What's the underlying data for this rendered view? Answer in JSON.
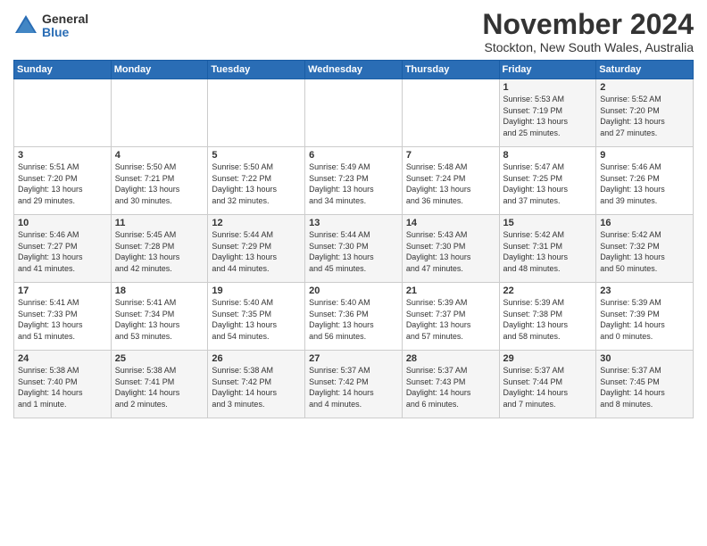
{
  "logo": {
    "general": "General",
    "blue": "Blue"
  },
  "title": "November 2024",
  "subtitle": "Stockton, New South Wales, Australia",
  "headers": [
    "Sunday",
    "Monday",
    "Tuesday",
    "Wednesday",
    "Thursday",
    "Friday",
    "Saturday"
  ],
  "weeks": [
    [
      {
        "day": "",
        "info": ""
      },
      {
        "day": "",
        "info": ""
      },
      {
        "day": "",
        "info": ""
      },
      {
        "day": "",
        "info": ""
      },
      {
        "day": "",
        "info": ""
      },
      {
        "day": "1",
        "info": "Sunrise: 5:53 AM\nSunset: 7:19 PM\nDaylight: 13 hours\nand 25 minutes."
      },
      {
        "day": "2",
        "info": "Sunrise: 5:52 AM\nSunset: 7:20 PM\nDaylight: 13 hours\nand 27 minutes."
      }
    ],
    [
      {
        "day": "3",
        "info": "Sunrise: 5:51 AM\nSunset: 7:20 PM\nDaylight: 13 hours\nand 29 minutes."
      },
      {
        "day": "4",
        "info": "Sunrise: 5:50 AM\nSunset: 7:21 PM\nDaylight: 13 hours\nand 30 minutes."
      },
      {
        "day": "5",
        "info": "Sunrise: 5:50 AM\nSunset: 7:22 PM\nDaylight: 13 hours\nand 32 minutes."
      },
      {
        "day": "6",
        "info": "Sunrise: 5:49 AM\nSunset: 7:23 PM\nDaylight: 13 hours\nand 34 minutes."
      },
      {
        "day": "7",
        "info": "Sunrise: 5:48 AM\nSunset: 7:24 PM\nDaylight: 13 hours\nand 36 minutes."
      },
      {
        "day": "8",
        "info": "Sunrise: 5:47 AM\nSunset: 7:25 PM\nDaylight: 13 hours\nand 37 minutes."
      },
      {
        "day": "9",
        "info": "Sunrise: 5:46 AM\nSunset: 7:26 PM\nDaylight: 13 hours\nand 39 minutes."
      }
    ],
    [
      {
        "day": "10",
        "info": "Sunrise: 5:46 AM\nSunset: 7:27 PM\nDaylight: 13 hours\nand 41 minutes."
      },
      {
        "day": "11",
        "info": "Sunrise: 5:45 AM\nSunset: 7:28 PM\nDaylight: 13 hours\nand 42 minutes."
      },
      {
        "day": "12",
        "info": "Sunrise: 5:44 AM\nSunset: 7:29 PM\nDaylight: 13 hours\nand 44 minutes."
      },
      {
        "day": "13",
        "info": "Sunrise: 5:44 AM\nSunset: 7:30 PM\nDaylight: 13 hours\nand 45 minutes."
      },
      {
        "day": "14",
        "info": "Sunrise: 5:43 AM\nSunset: 7:30 PM\nDaylight: 13 hours\nand 47 minutes."
      },
      {
        "day": "15",
        "info": "Sunrise: 5:42 AM\nSunset: 7:31 PM\nDaylight: 13 hours\nand 48 minutes."
      },
      {
        "day": "16",
        "info": "Sunrise: 5:42 AM\nSunset: 7:32 PM\nDaylight: 13 hours\nand 50 minutes."
      }
    ],
    [
      {
        "day": "17",
        "info": "Sunrise: 5:41 AM\nSunset: 7:33 PM\nDaylight: 13 hours\nand 51 minutes."
      },
      {
        "day": "18",
        "info": "Sunrise: 5:41 AM\nSunset: 7:34 PM\nDaylight: 13 hours\nand 53 minutes."
      },
      {
        "day": "19",
        "info": "Sunrise: 5:40 AM\nSunset: 7:35 PM\nDaylight: 13 hours\nand 54 minutes."
      },
      {
        "day": "20",
        "info": "Sunrise: 5:40 AM\nSunset: 7:36 PM\nDaylight: 13 hours\nand 56 minutes."
      },
      {
        "day": "21",
        "info": "Sunrise: 5:39 AM\nSunset: 7:37 PM\nDaylight: 13 hours\nand 57 minutes."
      },
      {
        "day": "22",
        "info": "Sunrise: 5:39 AM\nSunset: 7:38 PM\nDaylight: 13 hours\nand 58 minutes."
      },
      {
        "day": "23",
        "info": "Sunrise: 5:39 AM\nSunset: 7:39 PM\nDaylight: 14 hours\nand 0 minutes."
      }
    ],
    [
      {
        "day": "24",
        "info": "Sunrise: 5:38 AM\nSunset: 7:40 PM\nDaylight: 14 hours\nand 1 minute."
      },
      {
        "day": "25",
        "info": "Sunrise: 5:38 AM\nSunset: 7:41 PM\nDaylight: 14 hours\nand 2 minutes."
      },
      {
        "day": "26",
        "info": "Sunrise: 5:38 AM\nSunset: 7:42 PM\nDaylight: 14 hours\nand 3 minutes."
      },
      {
        "day": "27",
        "info": "Sunrise: 5:37 AM\nSunset: 7:42 PM\nDaylight: 14 hours\nand 4 minutes."
      },
      {
        "day": "28",
        "info": "Sunrise: 5:37 AM\nSunset: 7:43 PM\nDaylight: 14 hours\nand 6 minutes."
      },
      {
        "day": "29",
        "info": "Sunrise: 5:37 AM\nSunset: 7:44 PM\nDaylight: 14 hours\nand 7 minutes."
      },
      {
        "day": "30",
        "info": "Sunrise: 5:37 AM\nSunset: 7:45 PM\nDaylight: 14 hours\nand 8 minutes."
      }
    ]
  ]
}
